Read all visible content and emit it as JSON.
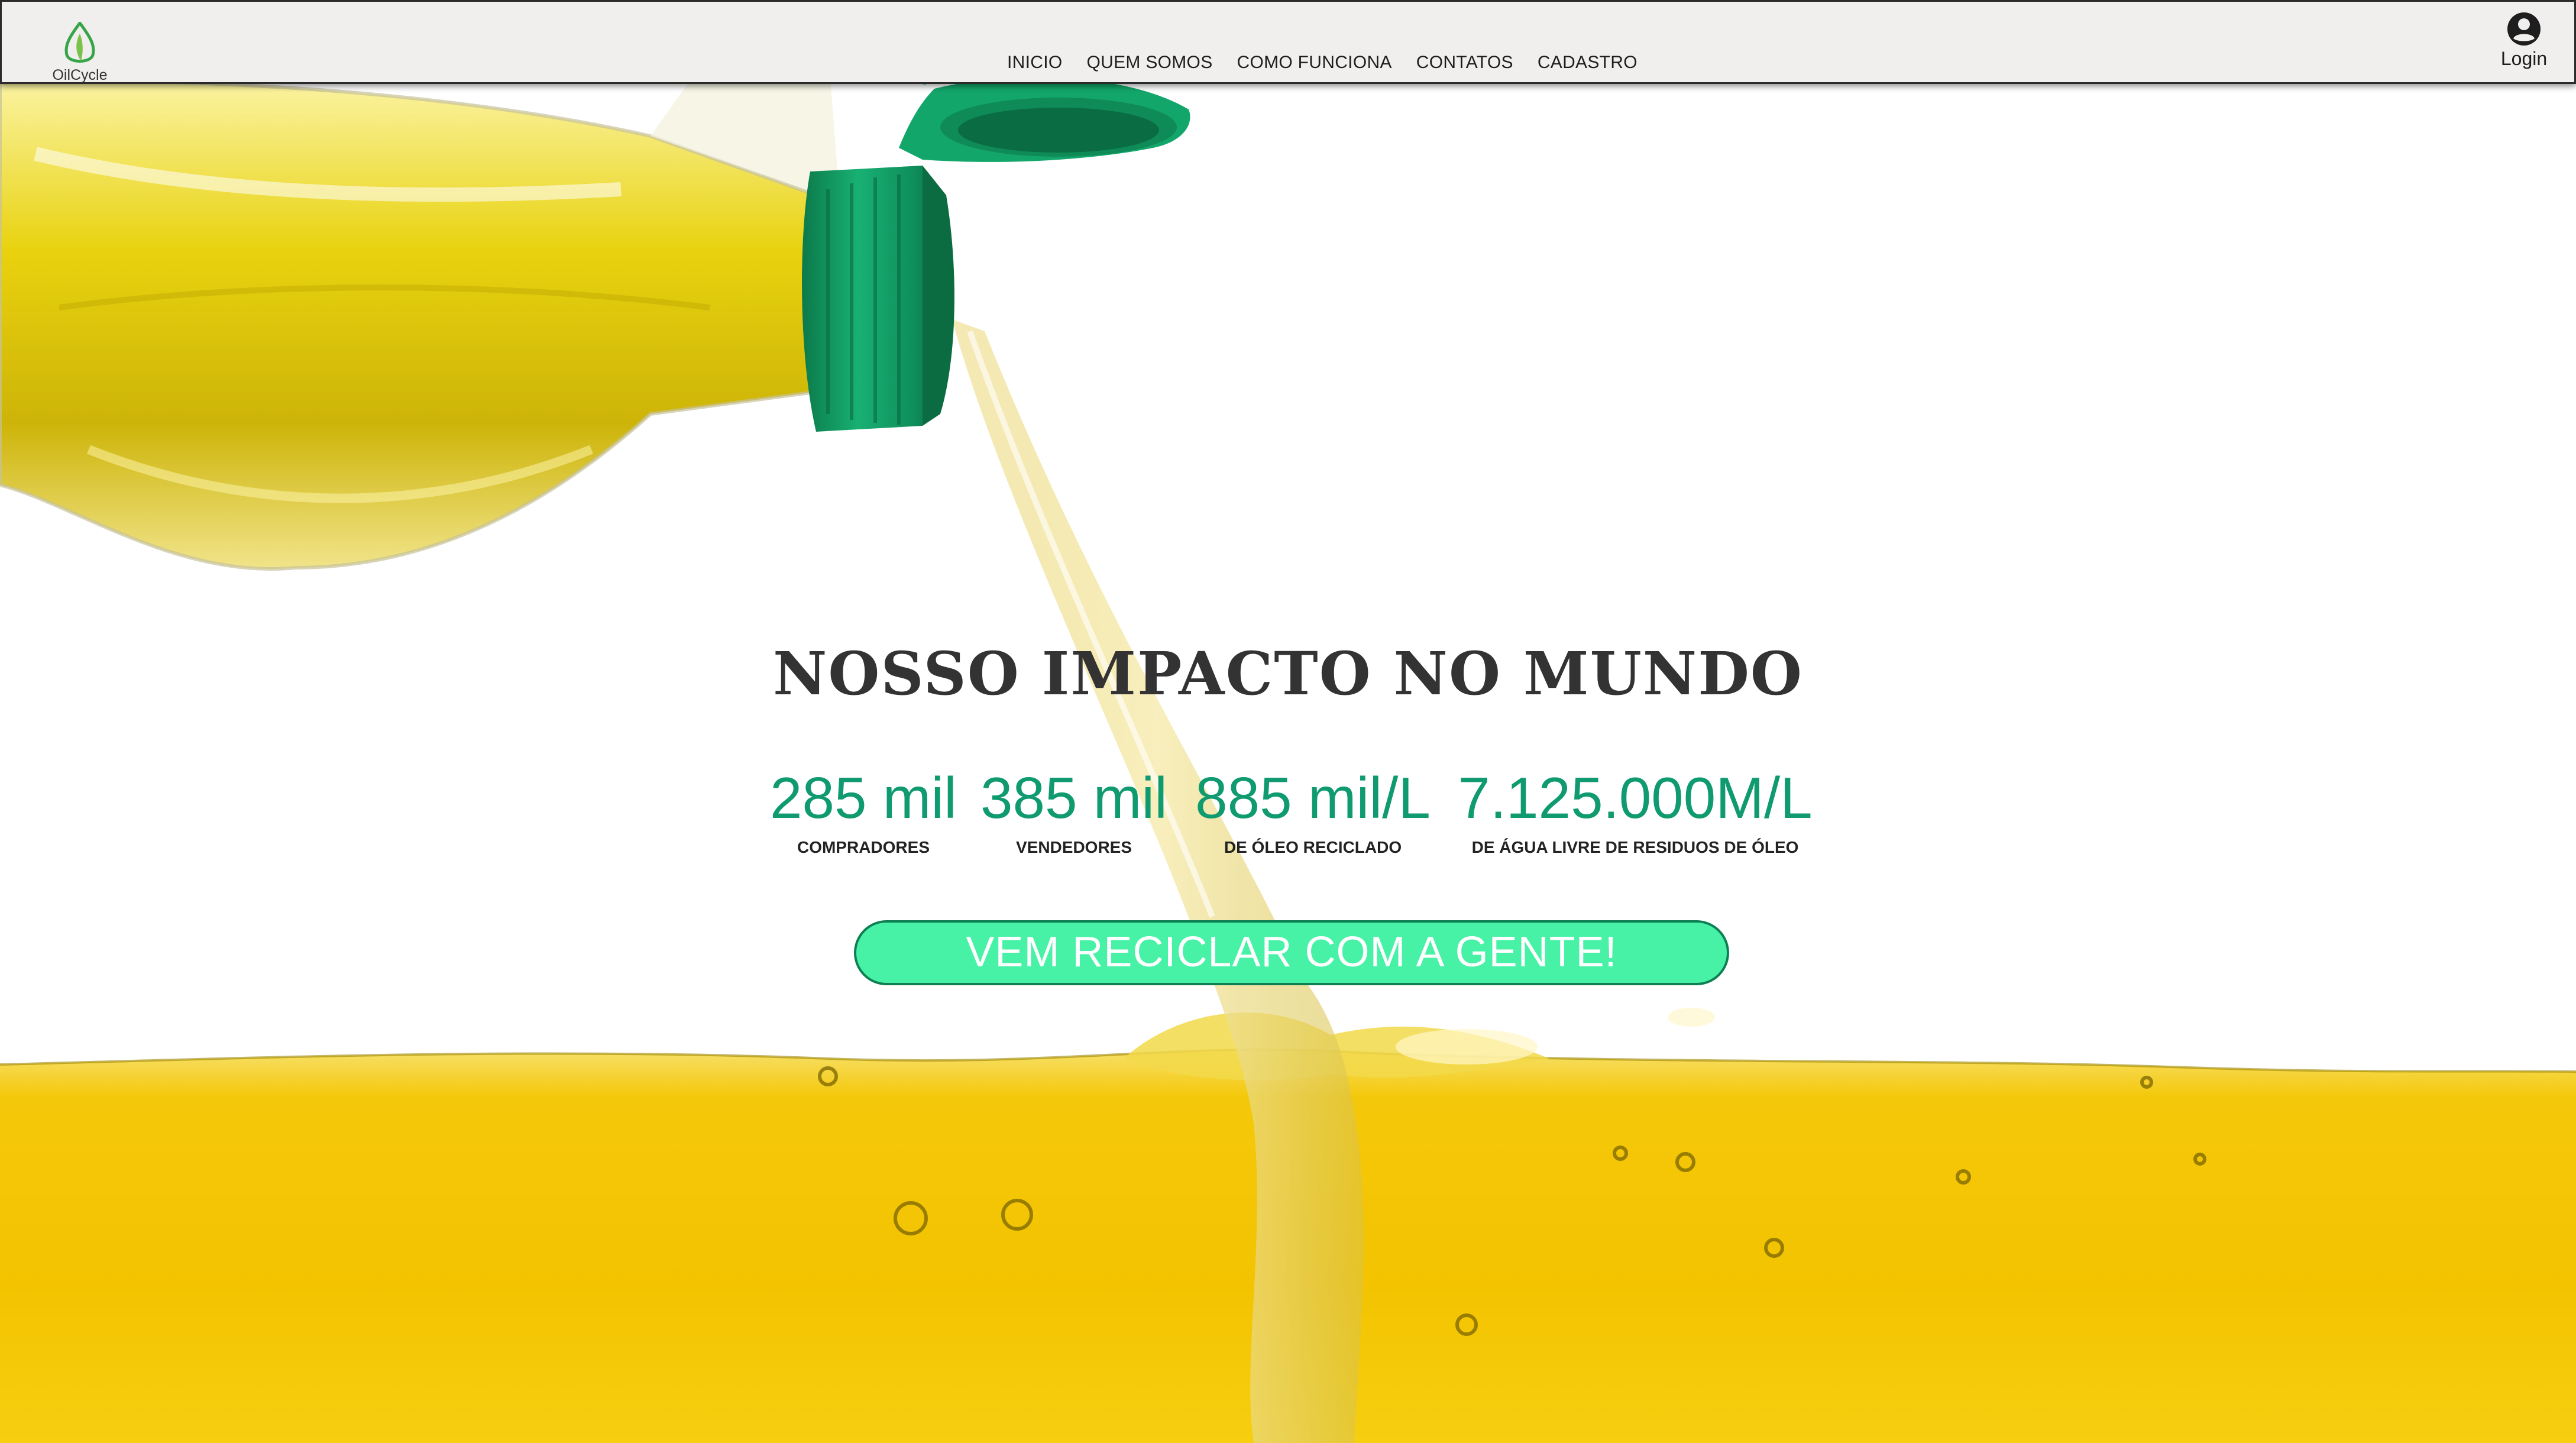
{
  "app": {
    "brand": "OilCycle"
  },
  "nav": {
    "items": [
      {
        "label": "INICIO"
      },
      {
        "label": "QUEM SOMOS"
      },
      {
        "label": "COMO FUNCIONA"
      },
      {
        "label": "CONTATOS"
      },
      {
        "label": "CADASTRO"
      }
    ],
    "login_label": "Login"
  },
  "hero": {
    "title": "NOSSO IMPACTO NO MUNDO",
    "stats": [
      {
        "value": "285 mil",
        "label": "COMPRADORES"
      },
      {
        "value": "385 mil",
        "label": "VENDEDORES"
      },
      {
        "value": "885 mil/L",
        "label": "DE ÓLEO RECICLADO"
      },
      {
        "value": "7.125.000M/L",
        "label": "DE ÁGUA LIVRE DE RESIDUOS DE ÓLEO"
      }
    ],
    "cta_label": "VEM RECICLAR COM A GENTE!"
  },
  "icons": {
    "logo": "leaf-drop-icon",
    "login": "user-circle-icon"
  },
  "colors": {
    "accent": "#0f9a70",
    "cta_fill": "#47f2a6",
    "cta_border": "#0e7f53",
    "oil": "#f2c400",
    "cap": "#11a163",
    "navbar_bg": "#f1eeee"
  }
}
